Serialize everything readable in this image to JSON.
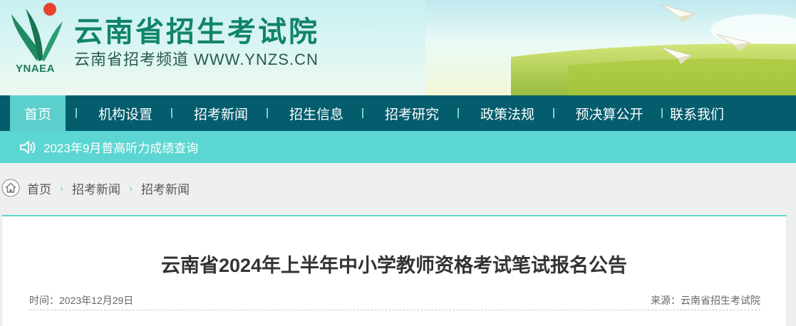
{
  "site": {
    "title": "云南省招生考试院",
    "subtitle": "云南省招考频道 WWW.YNZS.CN",
    "logo_abbr": "YNAEA",
    "logo_icon": "ynaea-logo-icon"
  },
  "nav": {
    "items": [
      {
        "label": "首页",
        "active": true
      },
      {
        "label": "机构设置"
      },
      {
        "label": "招考新闻"
      },
      {
        "label": "招生信息"
      },
      {
        "label": "招考研究"
      },
      {
        "label": "政策法规"
      },
      {
        "label": "预决算公开"
      },
      {
        "label": "联系我们"
      }
    ]
  },
  "notice": {
    "icon": "speaker-icon",
    "text": "2023年9月普高听力成绩查询"
  },
  "breadcrumb": {
    "icon": "home-icon",
    "items": [
      "首页",
      "招考新闻",
      "招考新闻"
    ],
    "separator": "›"
  },
  "article": {
    "title": "云南省2024年上半年中小学教师资格考试笔试报名公告",
    "time": "时间：2023年12月29日",
    "source": "来源：云南省招生考试院"
  },
  "colors": {
    "nav_bg": "#045d6d",
    "accent": "#5cd6d2",
    "brand_green": "#10846a"
  }
}
